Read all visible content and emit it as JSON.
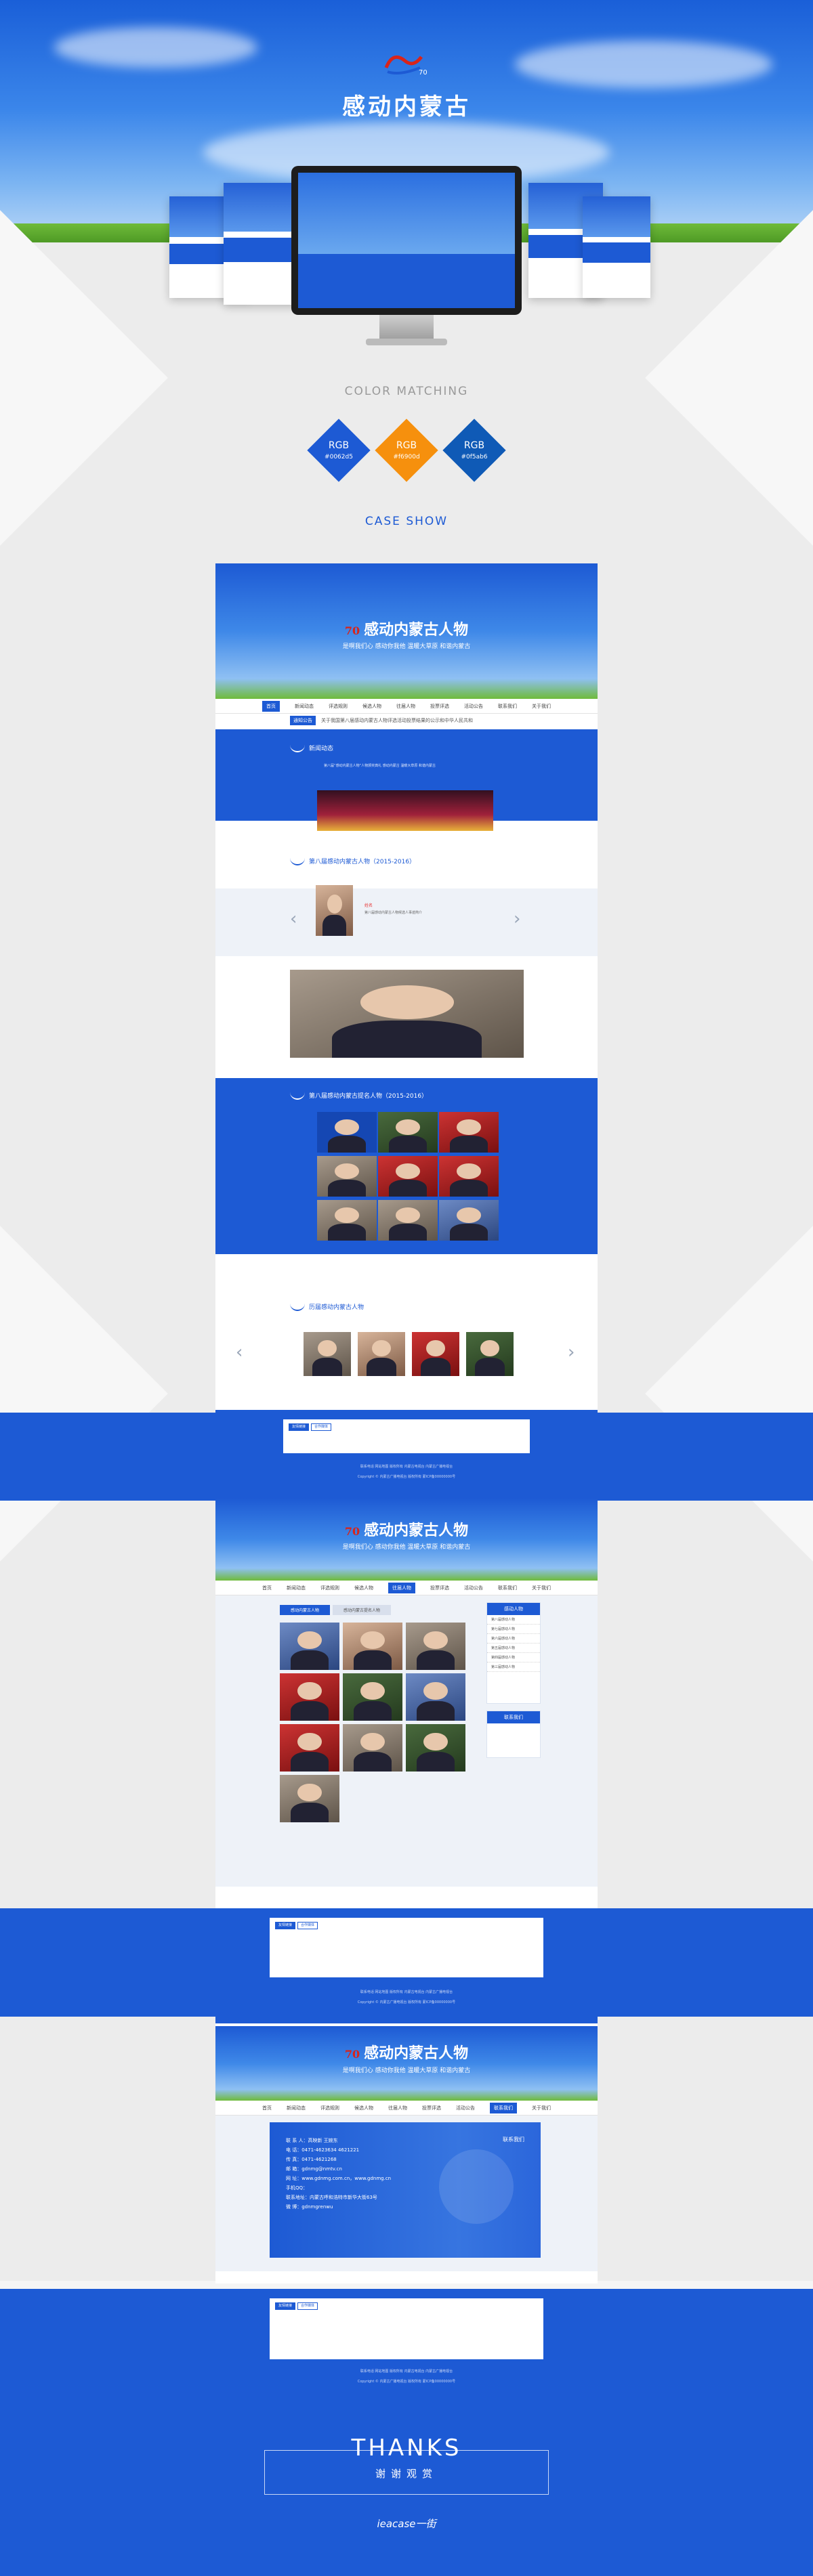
{
  "hero": {
    "title": "感动内蒙古",
    "logo_mark": "70"
  },
  "color_matching": {
    "label": "COLOR MATCHING",
    "swatches": [
      {
        "name": "RGB",
        "hex": "#0062d5",
        "color": "#1d5ad4"
      },
      {
        "name": "RGB",
        "hex": "#f6900d",
        "color": "#f6900d"
      },
      {
        "name": "RGB",
        "hex": "#0f5ab6",
        "color": "#0f5ab6"
      }
    ]
  },
  "case_show": {
    "label": "CASE SHOW"
  },
  "site": {
    "banner_title": "感动内蒙古人物",
    "banner_sub": "是啊我们心 感动你我他 温暖大草原 和谐内蒙古",
    "nav": [
      "首页",
      "新闻动态",
      "评选规则",
      "候选人物",
      "往届人物",
      "投票评选",
      "活动公告",
      "联系我们",
      "关于我们"
    ],
    "notice_tag": "通知公告",
    "notice_text": "关于我国第八届感动内蒙古人物评选活动投票结果的公示和中华人民共和",
    "news_title": "新闻动态",
    "news_text": "第八届“感动内蒙古人物”人物颁奖典礼 感动内蒙古 温暖大草原 和谐内蒙古",
    "section_eighth": "第八届感动内蒙古人物（2015-2016）",
    "person_name": "姓名",
    "person_desc": "第八届感动内蒙古人物候选人事迹简介",
    "section_eighth_nom": "第八届感动内蒙古提名人物（2015-2016）",
    "section_past": "历届感动内蒙古人物",
    "footer_tabs": [
      "友情链接",
      "合作媒体"
    ],
    "footer_text": "联系电话 网站地图 版权所有 内蒙古电视台 内蒙古广播电视台",
    "copyright": "Copyright © 内蒙古广播电视台 版权所有 蒙ICP备00000000号"
  },
  "list_page": {
    "tabs": [
      "感动内蒙古人物",
      "感动内蒙古提名人物"
    ],
    "side_title": "感动人物",
    "side_items": [
      "第八届感动人物",
      "第七届感动人物",
      "第六届感动人物",
      "第五届感动人物",
      "第四届感动人物",
      "第三届感动人物"
    ],
    "side_contact": "联系我们"
  },
  "contact_page": {
    "head": "联系我们",
    "lines": [
      "联 系 人：高映新  王婉东",
      "电    话：0471-4623634  4621221",
      "传    真：0471-4621268",
      "邮    箱：gdnmg@nmtv.cn",
      "网    址：www.gdnmg.com.cn，www.gdnmg.cn",
      "手机QQ：",
      "联系地址：内蒙古呼和浩特市新华大街63号",
      "微    博：gdnmgrenwu"
    ]
  },
  "thanks": {
    "title": "THANKS",
    "sub": "谢谢观赏",
    "brand": "ieacase一街"
  }
}
